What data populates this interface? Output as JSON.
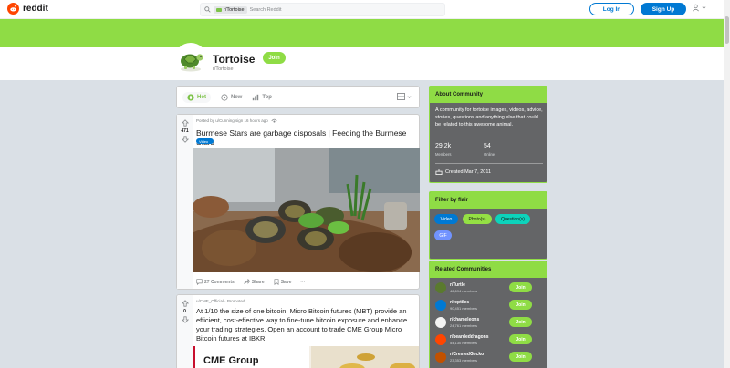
{
  "header": {
    "logo_text": "reddit",
    "search_chip": "r/Tortoise",
    "search_placeholder": "Search Reddit",
    "login_label": "Log In",
    "signup_label": "Sign Up"
  },
  "subreddit": {
    "title": "Tortoise",
    "name": "r/Tortoise",
    "join_label": "Join",
    "banner_color": "#8fdc45"
  },
  "sortbar": {
    "items": [
      {
        "label": "Hot",
        "icon": "flame-icon",
        "active": true
      },
      {
        "label": "New",
        "icon": "new-icon",
        "active": false
      },
      {
        "label": "Top",
        "icon": "top-icon",
        "active": false
      }
    ],
    "more": "···"
  },
  "post": {
    "votes": "471",
    "meta_posted": "Posted by u/Cunning sign 16 hours ago",
    "title": "Burmese Stars are garbage disposals | Feeding the Burmese Stars",
    "flair": "Video",
    "actions": {
      "comments": "27 Comments",
      "share": "Share",
      "save": "Save",
      "more": "···"
    }
  },
  "promoted": {
    "votes": "0",
    "meta": "u/CME_Official · Promoted",
    "title": "At 1/10 the size of one bitcoin, Micro Bitcoin futures (MBT) provide an efficient, cost-effective way to fine-tune bitcoin exposure and enhance your trading strategies. Open an account to trade CME Group Micro Bitcoin futures at IBKR.",
    "brand": "CME Group"
  },
  "about": {
    "heading": "About Community",
    "description": "A community for tortoise images, videos, advice, stories, questions and anything else that could be related to this awesome animal.",
    "members_count": "29.2k",
    "members_label": "Members",
    "online_count": "54",
    "online_label": "Online",
    "created": "Created Mar 7, 2011"
  },
  "filter": {
    "heading": "Filter by flair",
    "flairs": [
      {
        "label": "Video",
        "color": "#0079d3",
        "text_color": "#ffffff"
      },
      {
        "label": "Photo(s)",
        "color": "#94e044",
        "text_color": "#1a1a1b"
      },
      {
        "label": "Question(s)",
        "color": "#0dd3bb",
        "text_color": "#1a1a1b"
      },
      {
        "label": "GIF",
        "color": "#7193ff",
        "text_color": "#ffffff"
      }
    ]
  },
  "related": {
    "heading": "Related Communities",
    "items": [
      {
        "name": "r/Turtle",
        "members": "46,694 members",
        "join": "Join",
        "icon_color": "#5a7a2e"
      },
      {
        "name": "r/reptiles",
        "members": "90,451 members",
        "join": "Join",
        "icon_color": "#0079d3"
      },
      {
        "name": "r/chameleons",
        "members": "24,761 members",
        "join": "Join",
        "icon_color": "#2e7d32"
      },
      {
        "name": "r/beardeddragons",
        "members": "54,130 members",
        "join": "Join",
        "icon_color": "#ff4500"
      },
      {
        "name": "r/CrestedGecko",
        "members": "23,353 members",
        "join": "Join",
        "icon_color": "#c25100"
      }
    ]
  }
}
